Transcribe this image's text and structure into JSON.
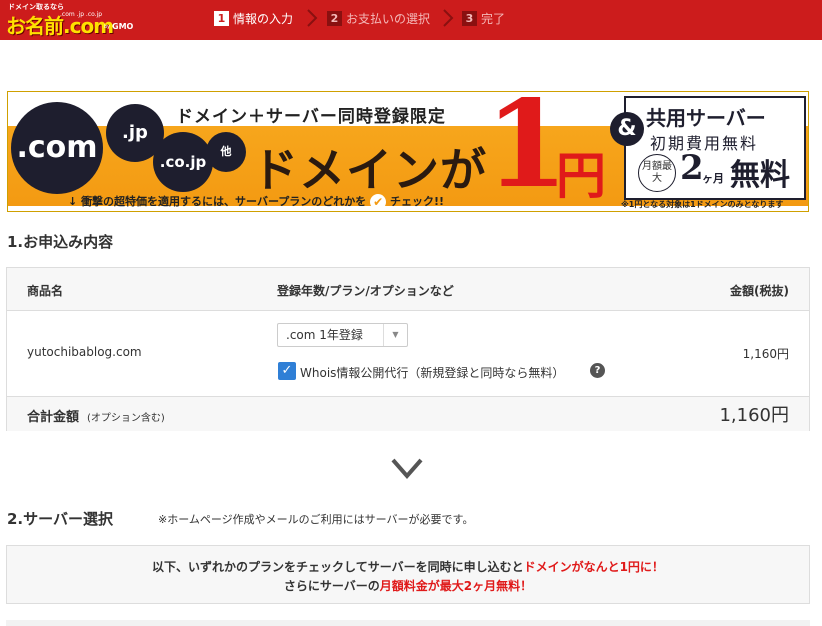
{
  "header": {
    "logo_tagline": "ドメイン取るなら",
    "logo_text": "お名前.com",
    "logo_tlds": ".com .jp .co.jp",
    "logo_by": "by",
    "logo_gmo": "GMO",
    "steps": [
      {
        "num": "1",
        "label": "情報の入力",
        "active": true
      },
      {
        "num": "2",
        "label": "お支払いの選択",
        "active": false
      },
      {
        "num": "3",
        "label": "完了",
        "active": false
      }
    ]
  },
  "banner": {
    "tld_com": ".com",
    "tld_jp": ".jp",
    "tld_cojp": ".co.jp",
    "tld_other": "他",
    "top_text": "ドメイン＋サーバー同時登録限定",
    "big_text": "ドメインが",
    "price_one": "1",
    "price_yen": "円",
    "note": "衝撃の超特価を適用するには、サーバープランのどれかを",
    "note_check": "チェック!!",
    "amp": "&",
    "server_title": "共用サーバー",
    "server_sub": "初期費用無料",
    "max_label": "月額最大",
    "months_num": "2",
    "months_unit": "ヶ月",
    "free": "無料",
    "footnote": "※1円となる対象は1ドメインのみとなります"
  },
  "section1": {
    "title": "1.お申込み内容",
    "headers": {
      "product": "商品名",
      "plan": "登録年数/プラン/オプションなど",
      "price": "金額(税抜)"
    },
    "row": {
      "domain": "yutochibablog.com",
      "select_value": ".com 1年登録",
      "whois_label": "Whois情報公開代行（新規登録と同時なら無料）",
      "whois_checked": true,
      "price": "1,160円"
    },
    "total_label": "合計金額",
    "total_sub": "(オプション含む)",
    "total_value": "1,160円"
  },
  "section2": {
    "title": "2.サーバー選択",
    "note": "※ホームページ作成やメールのご利用にはサーバーが必要です。",
    "notice_line1_a": "以下、いずれかのプランをチェックしてサーバーを同時に申し込むと",
    "notice_line1_b": "ドメインがなんと1円に！",
    "notice_line2_a": "さらにサーバーの",
    "notice_line2_b": "月額料金が最大2ヶ月無料！"
  },
  "icons": [
    "step-chevron-icon",
    "checkmark-icon",
    "help-icon",
    "dropdown-arrow-icon",
    "chevron-down-icon"
  ],
  "colors": {
    "brand_red": "#cc1c1c",
    "banner_orange": "#f39a12",
    "accent_red": "#e01a1a",
    "check_blue": "#2f7fd6"
  }
}
